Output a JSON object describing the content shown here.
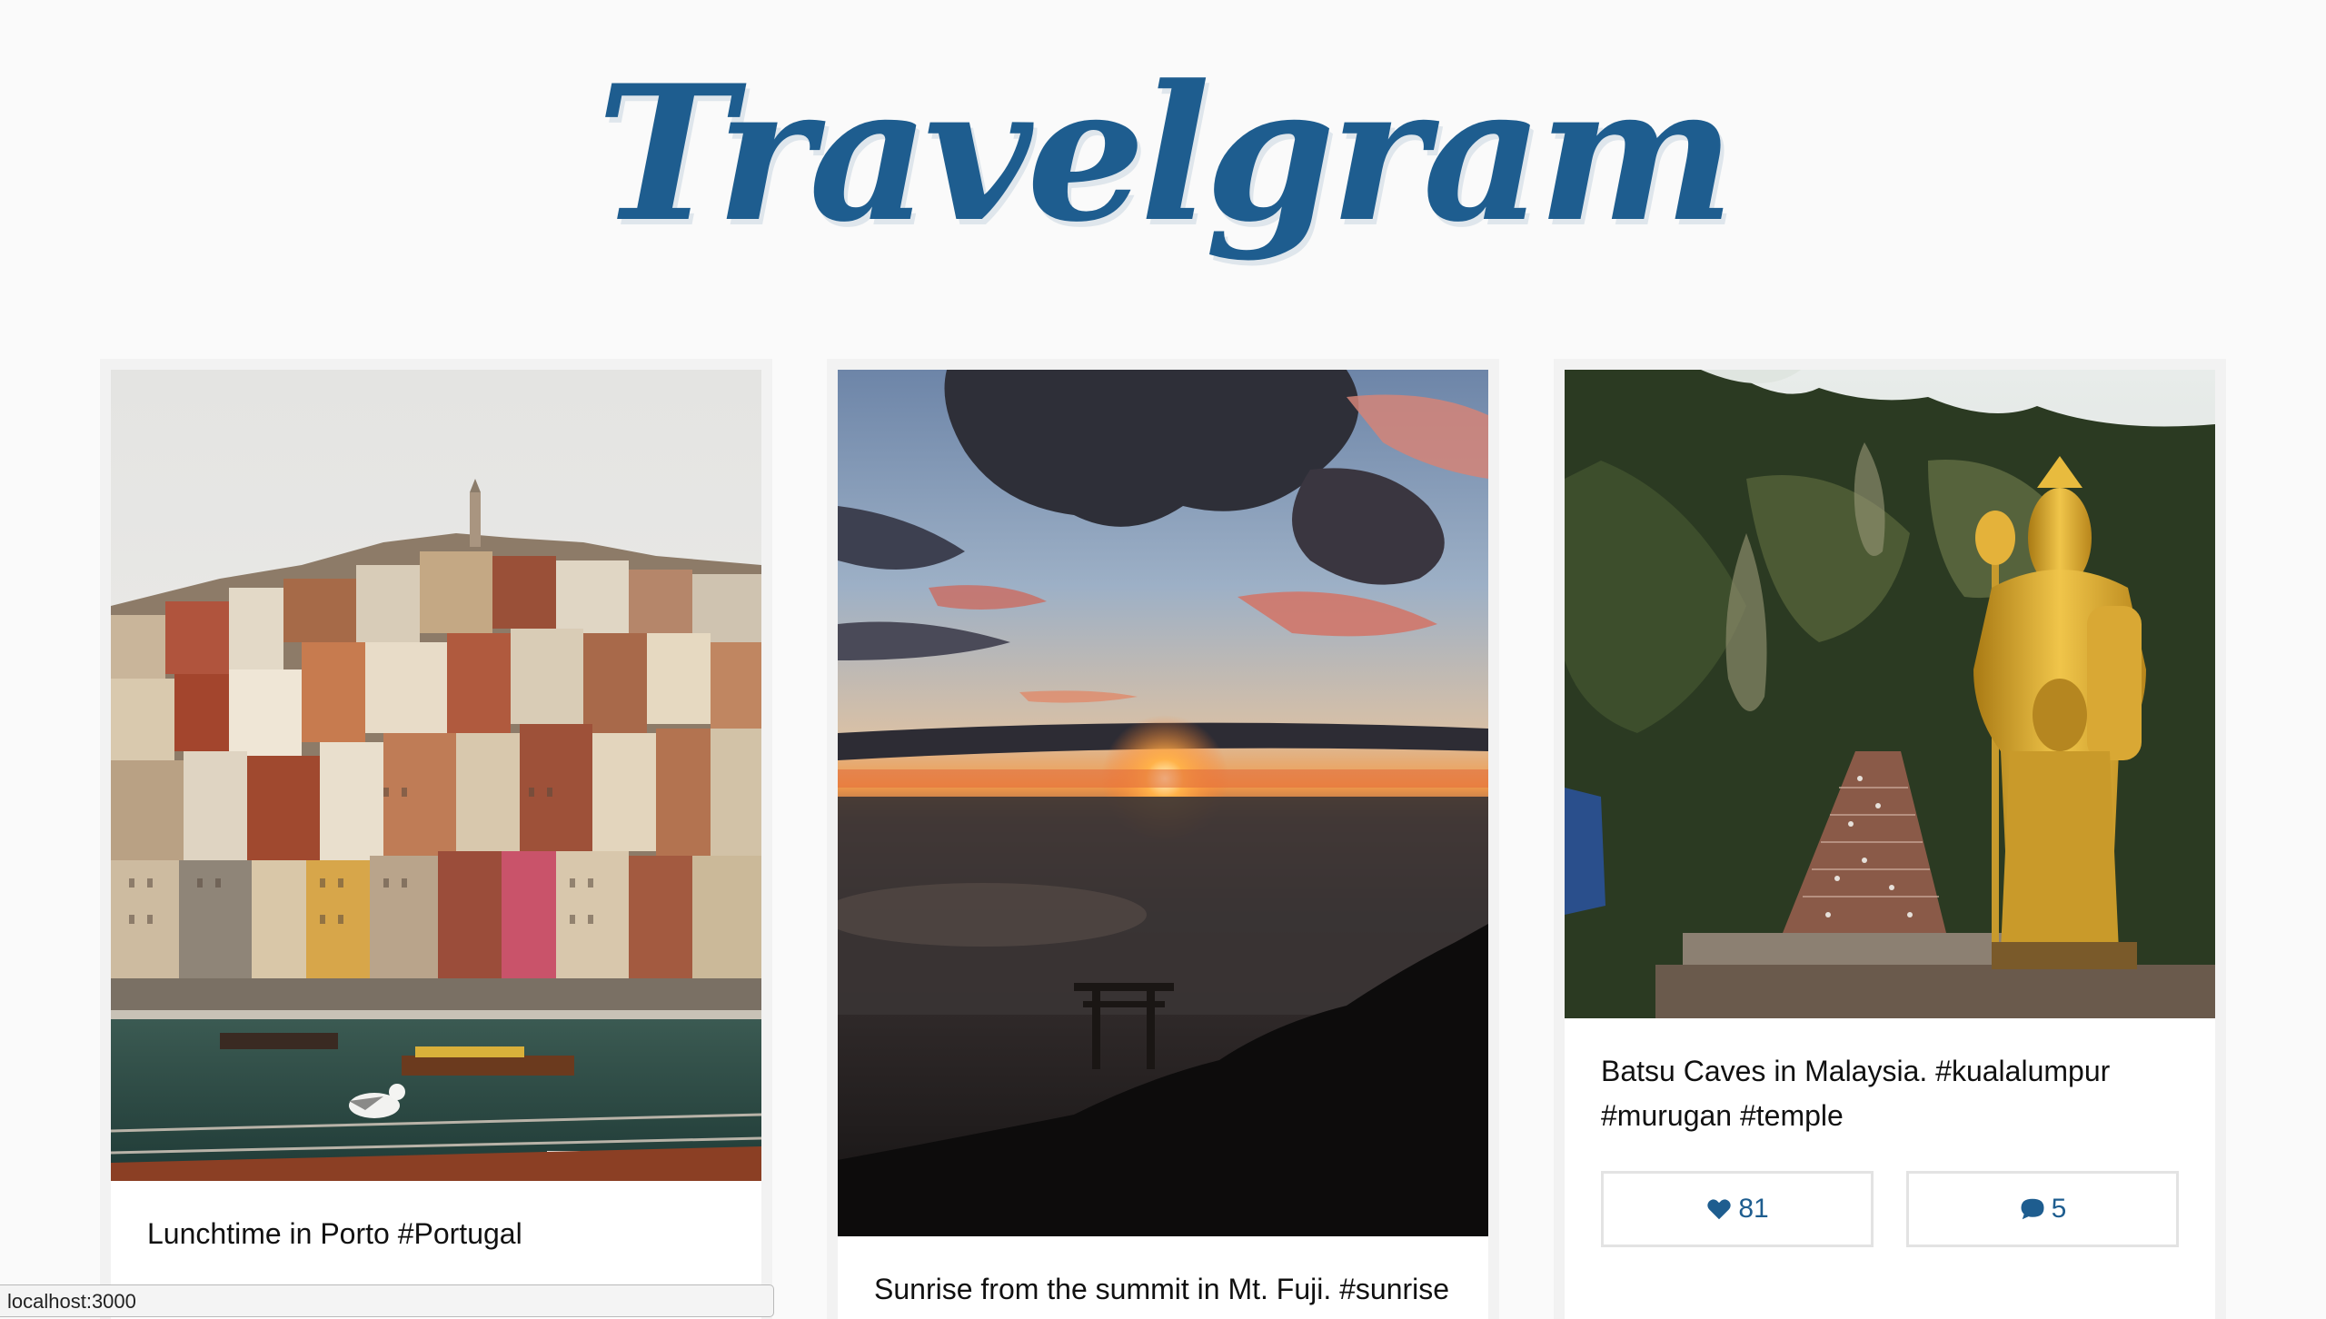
{
  "app": {
    "logo_text": "Travelgram",
    "brand_color": "#1e5d8f"
  },
  "posts": [
    {
      "caption": "Lunchtime in Porto #Portugal",
      "photo_subject": "porto-hillside-city"
    },
    {
      "caption": "Sunrise from the summit in Mt. Fuji. #sunrise",
      "photo_subject": "mt-fuji-sunrise"
    },
    {
      "caption": "Batsu Caves in Malaysia. #kualalumpur #murugan #temple",
      "photo_subject": "batu-caves-statue",
      "likes": "81",
      "comments": "5",
      "like_icon": "heart-icon",
      "comment_icon": "speech-bubble-icon"
    }
  ],
  "status_bar": {
    "url": "localhost:3000"
  }
}
